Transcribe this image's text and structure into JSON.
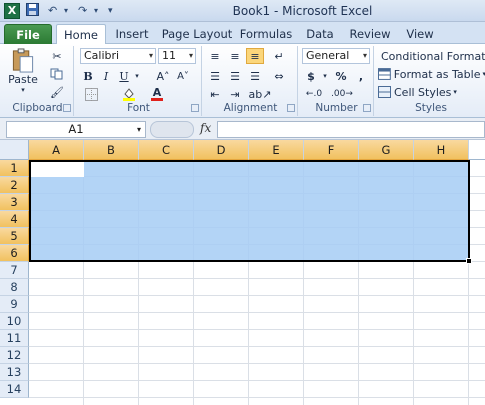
{
  "titlebar": {
    "title": "Book1  -  Microsoft Excel",
    "logo": "X",
    "qat_save": "save-icon",
    "qat_undo": "↶",
    "qat_redo": "↷"
  },
  "tabs": [
    {
      "label": "File"
    },
    {
      "label": "Home"
    },
    {
      "label": "Insert"
    },
    {
      "label": "Page Layout"
    },
    {
      "label": "Formulas"
    },
    {
      "label": "Data"
    },
    {
      "label": "Review"
    },
    {
      "label": "View"
    }
  ],
  "ribbon": {
    "clipboard": {
      "label": "Clipboard",
      "paste": "Paste"
    },
    "font": {
      "label": "Font",
      "name": "Calibri",
      "size": "11",
      "bold": "B",
      "italic": "I",
      "underline": "U",
      "grow": "A˄",
      "shrink": "A˅",
      "fontcolor": "A"
    },
    "alignment": {
      "label": "Alignment"
    },
    "number": {
      "label": "Number",
      "format": "General",
      "currency": "$",
      "percent": "%",
      "comma": ","
    },
    "styles": {
      "label": "Styles",
      "conditional": "Conditional Formatti",
      "table": "Format as Table",
      "cell": "Cell Styles"
    }
  },
  "formula_bar": {
    "name_box": "A1",
    "fx": "fx",
    "value": ""
  },
  "grid": {
    "columns": [
      "A",
      "B",
      "C",
      "D",
      "E",
      "F",
      "G",
      "H"
    ],
    "rows": [
      "1",
      "2",
      "3",
      "4",
      "5",
      "6",
      "7",
      "8",
      "9",
      "10",
      "11",
      "12",
      "13",
      "14"
    ],
    "selected_range": "A1:H6",
    "active_cell": "A1"
  },
  "colors": {
    "selection": "#a6cdf5",
    "header_selected": "#f1c15f",
    "file_tab": "#2b7a33"
  }
}
